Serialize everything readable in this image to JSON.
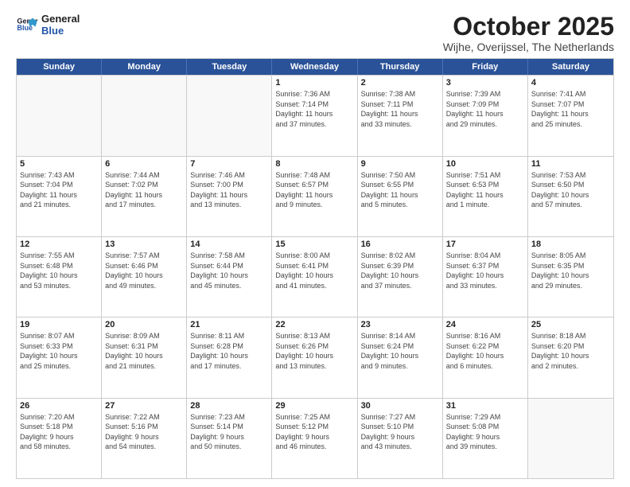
{
  "logo": {
    "line1": "General",
    "line2": "Blue"
  },
  "title": "October 2025",
  "location": "Wijhe, Overijssel, The Netherlands",
  "header_days": [
    "Sunday",
    "Monday",
    "Tuesday",
    "Wednesday",
    "Thursday",
    "Friday",
    "Saturday"
  ],
  "rows": [
    [
      {
        "day": "",
        "info": ""
      },
      {
        "day": "",
        "info": ""
      },
      {
        "day": "",
        "info": ""
      },
      {
        "day": "1",
        "info": "Sunrise: 7:36 AM\nSunset: 7:14 PM\nDaylight: 11 hours\nand 37 minutes."
      },
      {
        "day": "2",
        "info": "Sunrise: 7:38 AM\nSunset: 7:11 PM\nDaylight: 11 hours\nand 33 minutes."
      },
      {
        "day": "3",
        "info": "Sunrise: 7:39 AM\nSunset: 7:09 PM\nDaylight: 11 hours\nand 29 minutes."
      },
      {
        "day": "4",
        "info": "Sunrise: 7:41 AM\nSunset: 7:07 PM\nDaylight: 11 hours\nand 25 minutes."
      }
    ],
    [
      {
        "day": "5",
        "info": "Sunrise: 7:43 AM\nSunset: 7:04 PM\nDaylight: 11 hours\nand 21 minutes."
      },
      {
        "day": "6",
        "info": "Sunrise: 7:44 AM\nSunset: 7:02 PM\nDaylight: 11 hours\nand 17 minutes."
      },
      {
        "day": "7",
        "info": "Sunrise: 7:46 AM\nSunset: 7:00 PM\nDaylight: 11 hours\nand 13 minutes."
      },
      {
        "day": "8",
        "info": "Sunrise: 7:48 AM\nSunset: 6:57 PM\nDaylight: 11 hours\nand 9 minutes."
      },
      {
        "day": "9",
        "info": "Sunrise: 7:50 AM\nSunset: 6:55 PM\nDaylight: 11 hours\nand 5 minutes."
      },
      {
        "day": "10",
        "info": "Sunrise: 7:51 AM\nSunset: 6:53 PM\nDaylight: 11 hours\nand 1 minute."
      },
      {
        "day": "11",
        "info": "Sunrise: 7:53 AM\nSunset: 6:50 PM\nDaylight: 10 hours\nand 57 minutes."
      }
    ],
    [
      {
        "day": "12",
        "info": "Sunrise: 7:55 AM\nSunset: 6:48 PM\nDaylight: 10 hours\nand 53 minutes."
      },
      {
        "day": "13",
        "info": "Sunrise: 7:57 AM\nSunset: 6:46 PM\nDaylight: 10 hours\nand 49 minutes."
      },
      {
        "day": "14",
        "info": "Sunrise: 7:58 AM\nSunset: 6:44 PM\nDaylight: 10 hours\nand 45 minutes."
      },
      {
        "day": "15",
        "info": "Sunrise: 8:00 AM\nSunset: 6:41 PM\nDaylight: 10 hours\nand 41 minutes."
      },
      {
        "day": "16",
        "info": "Sunrise: 8:02 AM\nSunset: 6:39 PM\nDaylight: 10 hours\nand 37 minutes."
      },
      {
        "day": "17",
        "info": "Sunrise: 8:04 AM\nSunset: 6:37 PM\nDaylight: 10 hours\nand 33 minutes."
      },
      {
        "day": "18",
        "info": "Sunrise: 8:05 AM\nSunset: 6:35 PM\nDaylight: 10 hours\nand 29 minutes."
      }
    ],
    [
      {
        "day": "19",
        "info": "Sunrise: 8:07 AM\nSunset: 6:33 PM\nDaylight: 10 hours\nand 25 minutes."
      },
      {
        "day": "20",
        "info": "Sunrise: 8:09 AM\nSunset: 6:31 PM\nDaylight: 10 hours\nand 21 minutes."
      },
      {
        "day": "21",
        "info": "Sunrise: 8:11 AM\nSunset: 6:28 PM\nDaylight: 10 hours\nand 17 minutes."
      },
      {
        "day": "22",
        "info": "Sunrise: 8:13 AM\nSunset: 6:26 PM\nDaylight: 10 hours\nand 13 minutes."
      },
      {
        "day": "23",
        "info": "Sunrise: 8:14 AM\nSunset: 6:24 PM\nDaylight: 10 hours\nand 9 minutes."
      },
      {
        "day": "24",
        "info": "Sunrise: 8:16 AM\nSunset: 6:22 PM\nDaylight: 10 hours\nand 6 minutes."
      },
      {
        "day": "25",
        "info": "Sunrise: 8:18 AM\nSunset: 6:20 PM\nDaylight: 10 hours\nand 2 minutes."
      }
    ],
    [
      {
        "day": "26",
        "info": "Sunrise: 7:20 AM\nSunset: 5:18 PM\nDaylight: 9 hours\nand 58 minutes."
      },
      {
        "day": "27",
        "info": "Sunrise: 7:22 AM\nSunset: 5:16 PM\nDaylight: 9 hours\nand 54 minutes."
      },
      {
        "day": "28",
        "info": "Sunrise: 7:23 AM\nSunset: 5:14 PM\nDaylight: 9 hours\nand 50 minutes."
      },
      {
        "day": "29",
        "info": "Sunrise: 7:25 AM\nSunset: 5:12 PM\nDaylight: 9 hours\nand 46 minutes."
      },
      {
        "day": "30",
        "info": "Sunrise: 7:27 AM\nSunset: 5:10 PM\nDaylight: 9 hours\nand 43 minutes."
      },
      {
        "day": "31",
        "info": "Sunrise: 7:29 AM\nSunset: 5:08 PM\nDaylight: 9 hours\nand 39 minutes."
      },
      {
        "day": "",
        "info": ""
      }
    ]
  ]
}
